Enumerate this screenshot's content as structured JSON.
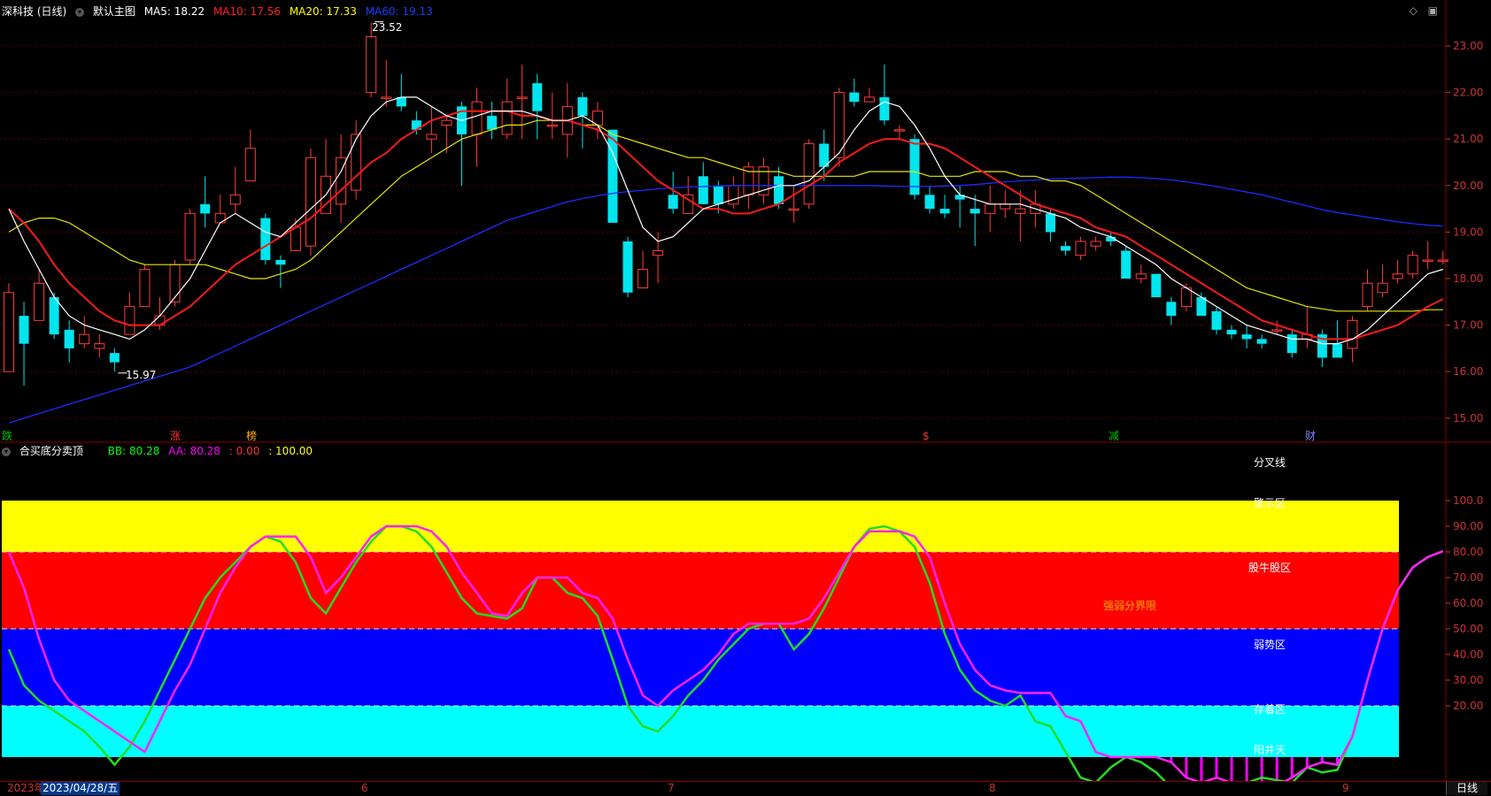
{
  "header": {
    "title": "深科技 (日线)",
    "main_label": "默认主图",
    "ma5": "MA5: 18.22",
    "ma10": "MA10: 17.56",
    "ma20": "MA20: 17.33",
    "ma60": "MA60: 19.13"
  },
  "window_icons": [
    "◇",
    "▣"
  ],
  "price_axis": [
    "23.00",
    "22.00",
    "21.00",
    "20.00",
    "19.00",
    "18.00",
    "17.00",
    "16.00",
    "15.00"
  ],
  "price_annotations": {
    "high": "23.52",
    "low": "15.97"
  },
  "events": [
    {
      "label": "跌",
      "color": "#00c000"
    },
    {
      "label": "涨",
      "color": "#ff3030"
    },
    {
      "label": "榜",
      "color": "#ffb000"
    },
    {
      "label": "$",
      "color": "#ff3030"
    },
    {
      "label": "减",
      "color": "#00c000"
    },
    {
      "label": "财",
      "color": "#8080ff"
    }
  ],
  "indicator": {
    "name": "合买底分卖顶",
    "bb": "BB: 80.28",
    "aa": "AA: 80.28",
    "v3": ": 0.00",
    "v4": ": 100.00",
    "axis": [
      "100.0",
      "90.00",
      "80.00",
      "70.00",
      "60.00",
      "50.00",
      "40.00",
      "30.00",
      "20.00"
    ],
    "zones": [
      "警示区",
      "股牛股区",
      "强弱分界限",
      "弱势区",
      "存着区",
      "阳井天"
    ],
    "top_label": "分叉线",
    "bb_series": [
      42,
      28,
      22,
      18,
      14,
      10,
      4,
      -3,
      4,
      14,
      26,
      38,
      50,
      62,
      70,
      76,
      82,
      86,
      84,
      76,
      62,
      56,
      66,
      76,
      84,
      90,
      90,
      88,
      82,
      72,
      62,
      56,
      55,
      54,
      58,
      70,
      70,
      64,
      62,
      55,
      38,
      20,
      12,
      10,
      16,
      24,
      30,
      38,
      44,
      50,
      52,
      52,
      42,
      48,
      58,
      70,
      82,
      89,
      90,
      88,
      82,
      68,
      48,
      34,
      26,
      22,
      20,
      24,
      14,
      12,
      2,
      -8,
      -10,
      -4,
      0,
      -2,
      -6,
      -12,
      -14,
      -12,
      -11,
      -10,
      -10,
      -8,
      -9,
      -10,
      -4,
      -6,
      -5,
      8,
      30,
      50,
      65,
      74,
      78,
      80.28
    ],
    "aa_series": [
      80,
      66,
      46,
      30,
      22,
      18,
      14,
      10,
      6,
      2,
      14,
      26,
      36,
      50,
      64,
      74,
      82,
      86,
      86,
      86,
      78,
      64,
      70,
      78,
      86,
      90,
      90,
      90,
      88,
      82,
      72,
      64,
      56,
      55,
      64,
      70,
      70,
      70,
      64,
      62,
      54,
      38,
      24,
      20,
      26,
      30,
      34,
      40,
      48,
      52,
      52,
      52,
      52,
      54,
      62,
      72,
      82,
      88,
      88,
      88,
      86,
      78,
      60,
      44,
      34,
      28,
      26,
      25,
      25,
      25,
      16,
      14,
      2,
      0,
      0,
      0,
      0,
      -2,
      -8,
      -10,
      -8,
      -10,
      -12,
      -10,
      -11,
      -8,
      -4,
      -2,
      -3,
      8,
      30,
      50,
      65,
      74,
      78,
      80.28
    ]
  },
  "candles": [
    [
      16.0,
      17.7,
      16.0,
      17.9
    ],
    [
      17.2,
      16.6,
      15.7,
      17.5
    ],
    [
      17.1,
      17.9,
      17.1,
      18.2
    ],
    [
      17.6,
      16.8,
      16.7,
      17.7
    ],
    [
      16.9,
      16.5,
      16.2,
      17.1
    ],
    [
      16.6,
      16.8,
      16.5,
      17.2
    ],
    [
      16.5,
      16.6,
      16.3,
      16.8
    ],
    [
      16.4,
      16.2,
      16.0,
      16.5
    ],
    [
      16.8,
      17.4,
      16.8,
      17.7
    ],
    [
      17.4,
      18.2,
      17.4,
      18.3
    ],
    [
      17.0,
      17.2,
      16.9,
      17.6
    ],
    [
      17.5,
      18.3,
      17.4,
      18.4
    ],
    [
      18.4,
      19.4,
      18.3,
      19.5
    ],
    [
      19.6,
      19.4,
      19.1,
      20.2
    ],
    [
      19.2,
      19.4,
      19.2,
      19.8
    ],
    [
      19.6,
      19.8,
      19.4,
      20.4
    ],
    [
      20.1,
      20.8,
      20.1,
      21.2
    ],
    [
      19.3,
      18.4,
      18.3,
      19.4
    ],
    [
      18.4,
      18.3,
      17.8,
      18.5
    ],
    [
      18.6,
      19.1,
      18.6,
      19.3
    ],
    [
      18.7,
      20.6,
      18.5,
      20.8
    ],
    [
      19.4,
      20.2,
      19.4,
      21.0
    ],
    [
      19.6,
      20.6,
      19.2,
      21.1
    ],
    [
      19.9,
      21.1,
      19.7,
      21.4
    ],
    [
      22.0,
      23.2,
      21.9,
      23.5
    ],
    [
      21.9,
      21.9,
      21.7,
      22.7
    ],
    [
      21.9,
      21.7,
      21.6,
      22.4
    ],
    [
      21.4,
      21.2,
      21.1,
      21.6
    ],
    [
      21.0,
      21.1,
      20.7,
      21.7
    ],
    [
      21.3,
      21.4,
      20.7,
      21.5
    ],
    [
      21.7,
      21.1,
      20.0,
      21.8
    ],
    [
      21.1,
      21.8,
      20.4,
      22.1
    ],
    [
      21.5,
      21.2,
      21.0,
      21.8
    ],
    [
      21.1,
      21.8,
      21.0,
      22.3
    ],
    [
      21.9,
      21.9,
      21.0,
      22.6
    ],
    [
      22.2,
      21.6,
      21.0,
      22.4
    ],
    [
      21.3,
      21.3,
      21.0,
      22.0
    ],
    [
      21.1,
      21.7,
      20.6,
      22.2
    ],
    [
      21.9,
      21.5,
      20.8,
      22.0
    ],
    [
      21.3,
      21.6,
      21.0,
      21.8
    ],
    [
      21.2,
      19.2,
      19.2,
      21.2
    ],
    [
      18.8,
      17.7,
      17.6,
      18.9
    ],
    [
      17.8,
      18.2,
      17.8,
      18.6
    ],
    [
      18.5,
      18.6,
      17.9,
      19.0
    ],
    [
      19.8,
      19.5,
      19.4,
      20.3
    ],
    [
      19.4,
      19.8,
      19.4,
      20.2
    ],
    [
      20.2,
      19.6,
      19.6,
      20.5
    ],
    [
      20.0,
      19.6,
      19.4,
      20.1
    ],
    [
      19.6,
      20.0,
      19.5,
      20.2
    ],
    [
      19.8,
      20.4,
      19.5,
      20.5
    ],
    [
      19.8,
      20.4,
      19.6,
      20.6
    ],
    [
      20.2,
      19.6,
      19.5,
      20.4
    ],
    [
      19.5,
      19.5,
      19.2,
      20.0
    ],
    [
      19.6,
      20.9,
      19.5,
      21.0
    ],
    [
      20.9,
      20.4,
      20.1,
      21.2
    ],
    [
      20.6,
      22.0,
      20.4,
      22.1
    ],
    [
      22.0,
      21.8,
      21.7,
      22.3
    ],
    [
      21.8,
      21.9,
      21.8,
      22.1
    ],
    [
      21.9,
      21.4,
      21.3,
      22.6
    ],
    [
      21.2,
      21.2,
      21.0,
      21.3
    ],
    [
      21.0,
      19.8,
      19.7,
      21.1
    ],
    [
      19.8,
      19.5,
      19.4,
      20.0
    ],
    [
      19.5,
      19.4,
      19.3,
      19.8
    ],
    [
      19.8,
      19.7,
      19.1,
      20.0
    ],
    [
      19.5,
      19.4,
      18.7,
      19.8
    ],
    [
      19.4,
      19.6,
      19.0,
      20.0
    ],
    [
      19.5,
      19.6,
      19.3,
      19.9
    ],
    [
      19.4,
      19.5,
      18.8,
      19.9
    ],
    [
      19.4,
      19.6,
      19.1,
      19.9
    ],
    [
      19.4,
      19.0,
      18.8,
      19.5
    ],
    [
      18.7,
      18.6,
      18.5,
      18.8
    ],
    [
      18.5,
      18.8,
      18.4,
      18.9
    ],
    [
      18.7,
      18.8,
      18.6,
      18.9
    ],
    [
      18.9,
      18.8,
      18.7,
      19.0
    ],
    [
      18.6,
      18.0,
      18.0,
      18.7
    ],
    [
      18.0,
      18.1,
      17.9,
      18.3
    ],
    [
      18.1,
      17.6,
      17.6,
      18.1
    ],
    [
      17.5,
      17.2,
      17.0,
      17.6
    ],
    [
      17.4,
      17.8,
      17.3,
      17.9
    ],
    [
      17.6,
      17.2,
      17.2,
      17.7
    ],
    [
      17.3,
      16.9,
      16.8,
      17.4
    ],
    [
      16.9,
      16.8,
      16.7,
      17.0
    ],
    [
      16.8,
      16.7,
      16.5,
      17.0
    ],
    [
      16.7,
      16.6,
      16.5,
      16.8
    ],
    [
      16.9,
      16.9,
      16.8,
      17.1
    ],
    [
      16.8,
      16.4,
      16.3,
      16.9
    ],
    [
      16.7,
      16.8,
      16.5,
      17.4
    ],
    [
      16.8,
      16.3,
      16.1,
      16.9
    ],
    [
      16.6,
      16.3,
      16.3,
      17.1
    ],
    [
      16.5,
      17.1,
      16.2,
      17.2
    ],
    [
      17.4,
      17.9,
      17.3,
      18.2
    ],
    [
      17.7,
      17.9,
      17.6,
      18.3
    ],
    [
      18.0,
      18.1,
      17.9,
      18.4
    ],
    [
      18.1,
      18.5,
      18.0,
      18.6
    ],
    [
      18.4,
      18.4,
      18.2,
      18.8
    ],
    [
      18.4,
      18.4,
      18.3,
      18.6
    ]
  ],
  "ma5": [
    19.5,
    18.8,
    18.2,
    17.6,
    17.2,
    17.0,
    16.9,
    16.8,
    16.7,
    16.9,
    17.2,
    17.6,
    18.0,
    18.6,
    19.2,
    19.4,
    19.2,
    19.0,
    18.9,
    19.2,
    19.5,
    19.8,
    20.3,
    21.0,
    21.5,
    21.8,
    21.9,
    21.9,
    21.7,
    21.5,
    21.4,
    21.5,
    21.6,
    21.6,
    21.6,
    21.5,
    21.4,
    21.4,
    21.5,
    21.3,
    20.7,
    19.9,
    19.1,
    18.8,
    18.9,
    19.2,
    19.5,
    19.6,
    19.7,
    19.8,
    19.9,
    20.0,
    20.0,
    20.1,
    20.4,
    20.7,
    21.2,
    21.6,
    21.8,
    21.7,
    21.3,
    20.8,
    20.2,
    19.8,
    19.7,
    19.6,
    19.6,
    19.6,
    19.5,
    19.4,
    19.3,
    19.1,
    19.0,
    18.9,
    18.7,
    18.5,
    18.3,
    18.0,
    17.8,
    17.6,
    17.4,
    17.2,
    17.0,
    16.9,
    16.8,
    16.7,
    16.7,
    16.6,
    16.6,
    16.7,
    16.9,
    17.2,
    17.5,
    17.8,
    18.1,
    18.2
  ],
  "ma10": [
    19.5,
    19.2,
    18.8,
    18.3,
    17.9,
    17.6,
    17.3,
    17.1,
    17.0,
    17.0,
    17.0,
    17.2,
    17.4,
    17.7,
    18.0,
    18.3,
    18.5,
    18.7,
    18.9,
    19.1,
    19.3,
    19.6,
    19.9,
    20.2,
    20.5,
    20.7,
    21.0,
    21.2,
    21.4,
    21.5,
    21.6,
    21.6,
    21.6,
    21.6,
    21.5,
    21.5,
    21.4,
    21.4,
    21.3,
    21.2,
    21.0,
    20.7,
    20.4,
    20.1,
    19.9,
    19.7,
    19.5,
    19.5,
    19.4,
    19.4,
    19.5,
    19.6,
    19.8,
    20.0,
    20.2,
    20.5,
    20.7,
    20.9,
    21.0,
    21.0,
    20.9,
    20.9,
    20.8,
    20.6,
    20.4,
    20.2,
    20.0,
    19.8,
    19.6,
    19.5,
    19.4,
    19.3,
    19.1,
    19.0,
    18.9,
    18.7,
    18.5,
    18.3,
    18.1,
    17.9,
    17.7,
    17.5,
    17.3,
    17.1,
    17.0,
    16.9,
    16.8,
    16.7,
    16.7,
    16.7,
    16.8,
    16.9,
    17.0,
    17.2,
    17.4,
    17.56
  ],
  "ma20": [
    19.0,
    19.2,
    19.3,
    19.3,
    19.2,
    19.0,
    18.8,
    18.6,
    18.4,
    18.3,
    18.3,
    18.3,
    18.3,
    18.3,
    18.2,
    18.1,
    18.0,
    18.0,
    18.1,
    18.2,
    18.4,
    18.7,
    19.0,
    19.3,
    19.6,
    19.9,
    20.2,
    20.4,
    20.6,
    20.8,
    21.0,
    21.1,
    21.2,
    21.3,
    21.3,
    21.4,
    21.4,
    21.4,
    21.3,
    21.3,
    21.1,
    21.0,
    20.9,
    20.8,
    20.7,
    20.6,
    20.6,
    20.5,
    20.4,
    20.3,
    20.3,
    20.3,
    20.2,
    20.2,
    20.2,
    20.2,
    20.2,
    20.3,
    20.3,
    20.3,
    20.3,
    20.2,
    20.2,
    20.2,
    20.3,
    20.3,
    20.3,
    20.2,
    20.2,
    20.1,
    20.1,
    20.0,
    19.8,
    19.6,
    19.4,
    19.2,
    19.0,
    18.8,
    18.6,
    18.4,
    18.2,
    18.0,
    17.8,
    17.7,
    17.6,
    17.5,
    17.4,
    17.35,
    17.3,
    17.3,
    17.3,
    17.3,
    17.3,
    17.3,
    17.33,
    17.33
  ],
  "ma60": [
    14.9,
    15.0,
    15.1,
    15.2,
    15.3,
    15.4,
    15.5,
    15.6,
    15.7,
    15.8,
    15.9,
    16.0,
    16.1,
    16.25,
    16.4,
    16.55,
    16.7,
    16.85,
    17.0,
    17.15,
    17.3,
    17.45,
    17.6,
    17.75,
    17.9,
    18.05,
    18.2,
    18.35,
    18.5,
    18.65,
    18.8,
    18.95,
    19.1,
    19.25,
    19.35,
    19.45,
    19.55,
    19.65,
    19.72,
    19.78,
    19.83,
    19.87,
    19.9,
    19.93,
    19.95,
    19.97,
    19.98,
    19.99,
    20.0,
    20.0,
    20.0,
    20.0,
    20.0,
    20.0,
    20.0,
    20.0,
    20.0,
    20.0,
    19.99,
    19.98,
    19.98,
    19.98,
    19.99,
    20.0,
    20.02,
    20.05,
    20.08,
    20.1,
    20.12,
    20.14,
    20.15,
    20.16,
    20.17,
    20.18,
    20.18,
    20.17,
    20.15,
    20.12,
    20.08,
    20.03,
    19.98,
    19.92,
    19.86,
    19.8,
    19.72,
    19.64,
    19.56,
    19.48,
    19.42,
    19.37,
    19.32,
    19.27,
    19.22,
    19.18,
    19.15,
    19.13
  ],
  "dates": {
    "year": "2023年",
    "cursor": "2023/04/28/五",
    "months": [
      "6",
      "7",
      "8",
      "9"
    ],
    "period": "日线"
  }
}
